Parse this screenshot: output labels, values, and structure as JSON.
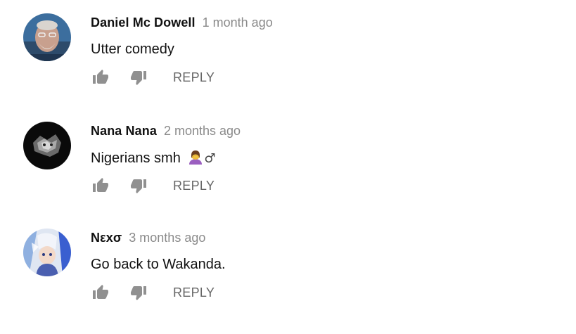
{
  "comments": [
    {
      "author": "Daniel Mc Dowell",
      "time": "1 month ago",
      "text": "Utter comedy",
      "reply_label": "REPLY"
    },
    {
      "author": "Nana Nana",
      "time": "2 months ago",
      "text": "Nigerians smh",
      "emoji": "woman-facepalming",
      "emoji_suffix": "♂",
      "reply_label": "REPLY"
    },
    {
      "author": "Nεxσ",
      "time": "3 months ago",
      "text": "Go back to Wakanda.",
      "reply_label": "REPLY"
    }
  ],
  "icons": {
    "like": "thumb-up-icon",
    "dislike": "thumb-down-icon"
  },
  "colors": {
    "author": "#111111",
    "timestamp": "#8a8a8a",
    "action": "#666666",
    "icon": "#909090"
  }
}
